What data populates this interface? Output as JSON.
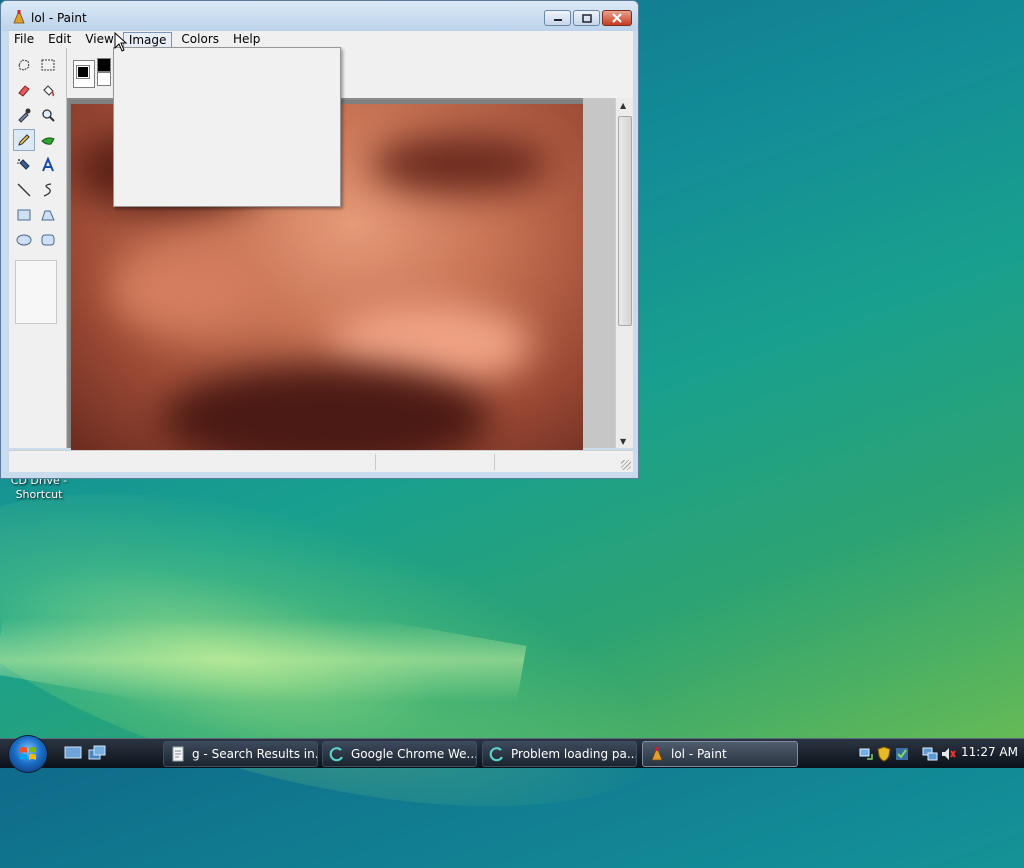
{
  "desktop": {
    "shortcut_label": "CD Drive - Shortcut"
  },
  "window": {
    "title": "lol - Paint",
    "menu": [
      "File",
      "Edit",
      "View",
      "Image",
      "Colors",
      "Help"
    ],
    "active_menu": "Image"
  },
  "toolbox": {
    "tools": [
      "free-form-select",
      "rectangle-select",
      "eraser",
      "fill",
      "color-picker",
      "magnifier",
      "pencil",
      "brush",
      "airbrush",
      "text",
      "line",
      "curve",
      "rectangle",
      "polygon",
      "ellipse",
      "rounded-rectangle"
    ],
    "selected_tool": "pencil"
  },
  "colors": {
    "primary": "#000000",
    "secondary": "#ffffff",
    "title_accent": "#0b5fa5"
  },
  "taskbar": {
    "tasks": [
      {
        "label": "g - Search Results in...",
        "icon": "document-icon"
      },
      {
        "label": "Google Chrome We...",
        "icon": "chrome-loading-icon"
      },
      {
        "label": "Problem loading pa...",
        "icon": "chrome-loading-icon"
      },
      {
        "label": "lol - Paint",
        "icon": "paint-icon",
        "active": true
      }
    ],
    "clock": "11:27 AM"
  }
}
